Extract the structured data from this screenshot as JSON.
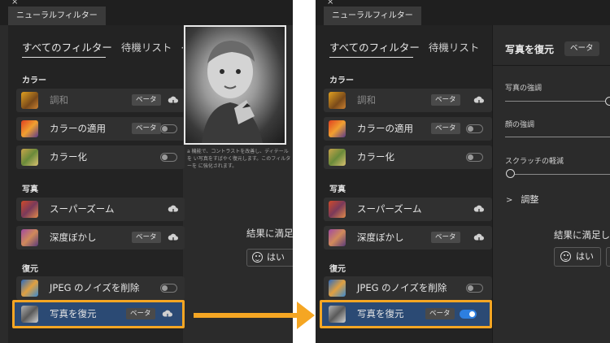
{
  "left": {
    "doc_tab": "ニューラルフィルター",
    "close_icon": "×",
    "tabs": [
      {
        "label": "すべてのフィルター",
        "active": true
      },
      {
        "label": "待機リスト",
        "active": false
      }
    ],
    "more_icon": "···",
    "sections": [
      {
        "title": "カラー"
      },
      {
        "title": "写真"
      },
      {
        "title": "復元"
      }
    ],
    "filters": [
      {
        "label": "調和",
        "badge": "ベータ",
        "action": "cloud-download",
        "dim": true
      },
      {
        "label": "カラーの適用",
        "badge": "ベータ",
        "action": "toggle-off"
      },
      {
        "label": "カラー化",
        "action": "toggle-off"
      },
      {
        "label": "スーパーズーム",
        "action": "cloud-download"
      },
      {
        "label": "深度ぼかし",
        "badge": "ベータ",
        "action": "cloud-download"
      },
      {
        "label": "JPEG のノイズを削除",
        "action": "toggle-off"
      },
      {
        "label": "写真を復元",
        "badge": "ベータ",
        "action": "cloud-download",
        "selected": true
      }
    ],
    "description": "a 機能で、コントラストを改善し、ディテールを い写真をすばやく復元します。このフィルターを に強化されます。",
    "satisfied_text": "結果に満足",
    "yes_label": "はい"
  },
  "right": {
    "doc_tab": "ニューラルフィルター",
    "close_icon": "×",
    "tabs": [
      {
        "label": "すべてのフィルター",
        "active": true
      },
      {
        "label": "待機リスト",
        "active": false
      }
    ],
    "sections": [
      {
        "title": "カラー"
      },
      {
        "title": "写真"
      },
      {
        "title": "復元"
      }
    ],
    "filters": [
      {
        "label": "調和",
        "badge": "ベータ",
        "action": "cloud-download",
        "dim": true
      },
      {
        "label": "カラーの適用",
        "badge": "ベータ",
        "action": "toggle-off"
      },
      {
        "label": "カラー化",
        "action": "toggle-off"
      },
      {
        "label": "スーパーズーム",
        "action": "cloud-download"
      },
      {
        "label": "深度ぼかし",
        "badge": "ベータ",
        "action": "cloud-download"
      },
      {
        "label": "JPEG のノイズを削除",
        "action": "toggle-off"
      },
      {
        "label": "写真を復元",
        "badge": "ベータ",
        "action": "toggle-on",
        "selected": true
      }
    ],
    "settings": {
      "title": "写真を復元",
      "badge": "ベータ",
      "sliders": [
        {
          "label": "写真の強調",
          "value": 1.0
        },
        {
          "label": "顔の強調",
          "value": 1.0
        },
        {
          "label": "スクラッチの軽減",
          "value": 0.0
        }
      ],
      "adjust_label": "調整",
      "satisfied_text": "結果に満足し",
      "yes_label": "はい"
    }
  },
  "colors": {
    "accent_highlight": "#f5a623",
    "selected_row": "#2b4a74",
    "toggle_on": "#2d7fe0",
    "panel_bg": "#2b2b2b"
  }
}
